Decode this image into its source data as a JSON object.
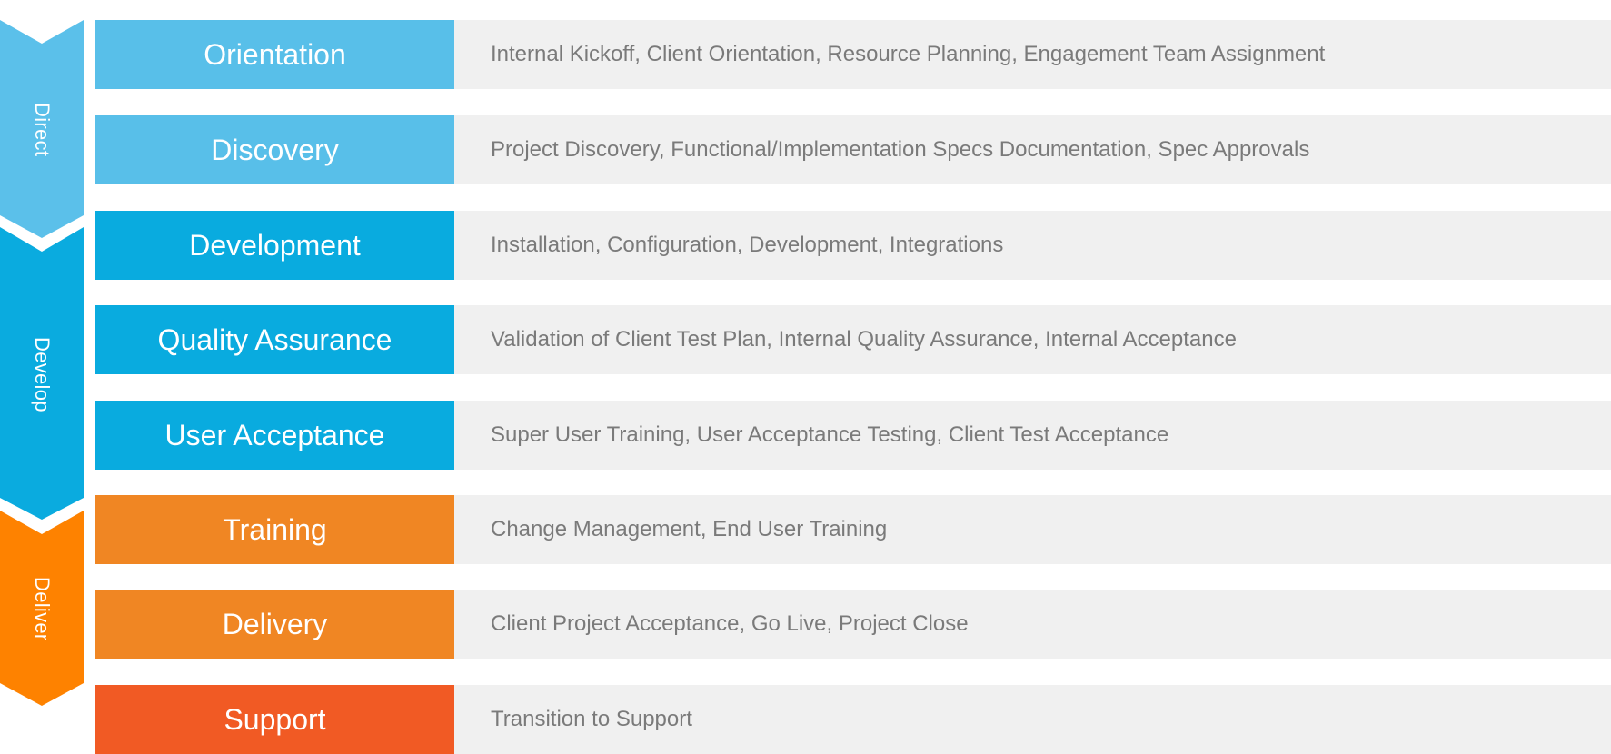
{
  "colors": {
    "direct": "#5bc0ea",
    "develop": "#0aabdf",
    "deliver": "#fe8200",
    "step_direct": "#58bfe9",
    "step_develop": "#09abdf",
    "step_deliver": "#f08623",
    "step_support": "#f15a24",
    "desc_bg": "#f0f0f0",
    "desc_text": "#7a7a7a"
  },
  "phases": [
    {
      "label": "Direct",
      "color": "#5bc0ea"
    },
    {
      "label": "Develop",
      "color": "#0aabdf"
    },
    {
      "label": "Deliver",
      "color": "#fe8200"
    }
  ],
  "steps": [
    {
      "name": "Orientation",
      "description": "Internal Kickoff, Client Orientation, Resource Planning, Engagement Team Assignment",
      "color": "#58bfe9",
      "phase": "Direct"
    },
    {
      "name": "Discovery",
      "description": "Project Discovery, Functional/Implementation Specs Documentation, Spec Approvals",
      "color": "#58bfe9",
      "phase": "Direct"
    },
    {
      "name": "Development",
      "description": "Installation, Configuration, Development, Integrations",
      "color": "#09abdf",
      "phase": "Develop"
    },
    {
      "name": "Quality Assurance",
      "description": "Validation of Client Test Plan, Internal Quality Assurance, Internal Acceptance",
      "color": "#09abdf",
      "phase": "Develop"
    },
    {
      "name": "User Acceptance",
      "description": "Super User Training, User Acceptance Testing, Client Test Acceptance",
      "color": "#09abdf",
      "phase": "Develop"
    },
    {
      "name": "Training",
      "description": "Change Management, End User Training",
      "color": "#f08623",
      "phase": "Deliver"
    },
    {
      "name": "Delivery",
      "description": "Client Project Acceptance, Go Live, Project Close",
      "color": "#f08623",
      "phase": "Deliver"
    },
    {
      "name": "Support",
      "description": "Transition to Support",
      "color": "#f15a24",
      "phase": ""
    }
  ]
}
